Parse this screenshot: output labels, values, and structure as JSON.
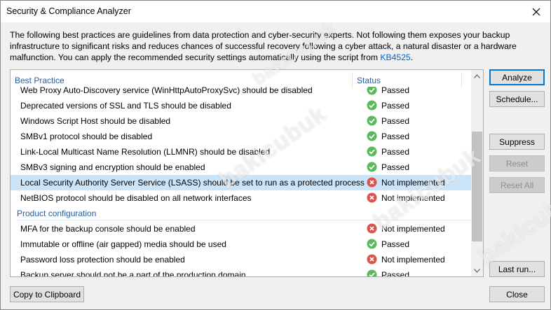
{
  "window": {
    "title": "Security & Compliance Analyzer"
  },
  "description": {
    "text_before_link": "The following best practices are guidelines from data protection and cyber-security experts. Not following them exposes your backup infrastructure to significant risks and reduces chances of successful recovery following a cyber attack, a natural disaster or a hardware malfunction. You can apply the recommended security settings automatically using the script from ",
    "link_text": "KB4525",
    "text_after_link": "."
  },
  "table": {
    "columns": [
      "Best Practice",
      "Status"
    ],
    "rows": [
      {
        "type": "item",
        "name": "Web Proxy Auto-Discovery service (WinHttpAutoProxySvc) should be disabled",
        "status": "Passed",
        "status_kind": "ok",
        "selected": false
      },
      {
        "type": "item",
        "name": "Deprecated versions of SSL and TLS should be disabled",
        "status": "Passed",
        "status_kind": "ok",
        "selected": false
      },
      {
        "type": "item",
        "name": "Windows Script Host should be disabled",
        "status": "Passed",
        "status_kind": "ok",
        "selected": false
      },
      {
        "type": "item",
        "name": "SMBv1 protocol should be disabled",
        "status": "Passed",
        "status_kind": "ok",
        "selected": false
      },
      {
        "type": "item",
        "name": "Link-Local Multicast Name Resolution (LLMNR) should be disabled",
        "status": "Passed",
        "status_kind": "ok",
        "selected": false
      },
      {
        "type": "item",
        "name": "SMBv3 signing and encryption should be enabled",
        "status": "Passed",
        "status_kind": "ok",
        "selected": false
      },
      {
        "type": "item",
        "name": "Local Security Authority Server Service (LSASS) should be set to run as a protected process",
        "status": "Not implemented",
        "status_kind": "fail",
        "selected": true
      },
      {
        "type": "item",
        "name": "NetBIOS protocol should be disabled on all network interfaces",
        "status": "Not implemented",
        "status_kind": "fail",
        "selected": false
      },
      {
        "type": "group",
        "name": "Product configuration"
      },
      {
        "type": "item",
        "name": "MFA for the backup console should be enabled",
        "status": "Not implemented",
        "status_kind": "fail",
        "selected": false
      },
      {
        "type": "item",
        "name": "Immutable or offline (air gapped) media should be used",
        "status": "Passed",
        "status_kind": "ok",
        "selected": false
      },
      {
        "type": "item",
        "name": "Password loss protection should be enabled",
        "status": "Not implemented",
        "status_kind": "fail",
        "selected": false
      },
      {
        "type": "item",
        "name": "Backup server should not be a part of the production domain",
        "status": "Passed",
        "status_kind": "ok",
        "selected": false
      }
    ]
  },
  "buttons": {
    "analyze": "Analyze",
    "schedule": "Schedule...",
    "suppress": "Suppress",
    "reset": "Reset",
    "reset_all": "Reset All",
    "last_run": "Last run...",
    "copy": "Copy to Clipboard",
    "close": "Close"
  },
  "colors": {
    "ok": "#5cb85c",
    "fail": "#d9534f",
    "selection": "#cce4f7",
    "header_text": "#1f5ea8",
    "link": "#0066cc"
  },
  "watermark": "bakicubuk"
}
